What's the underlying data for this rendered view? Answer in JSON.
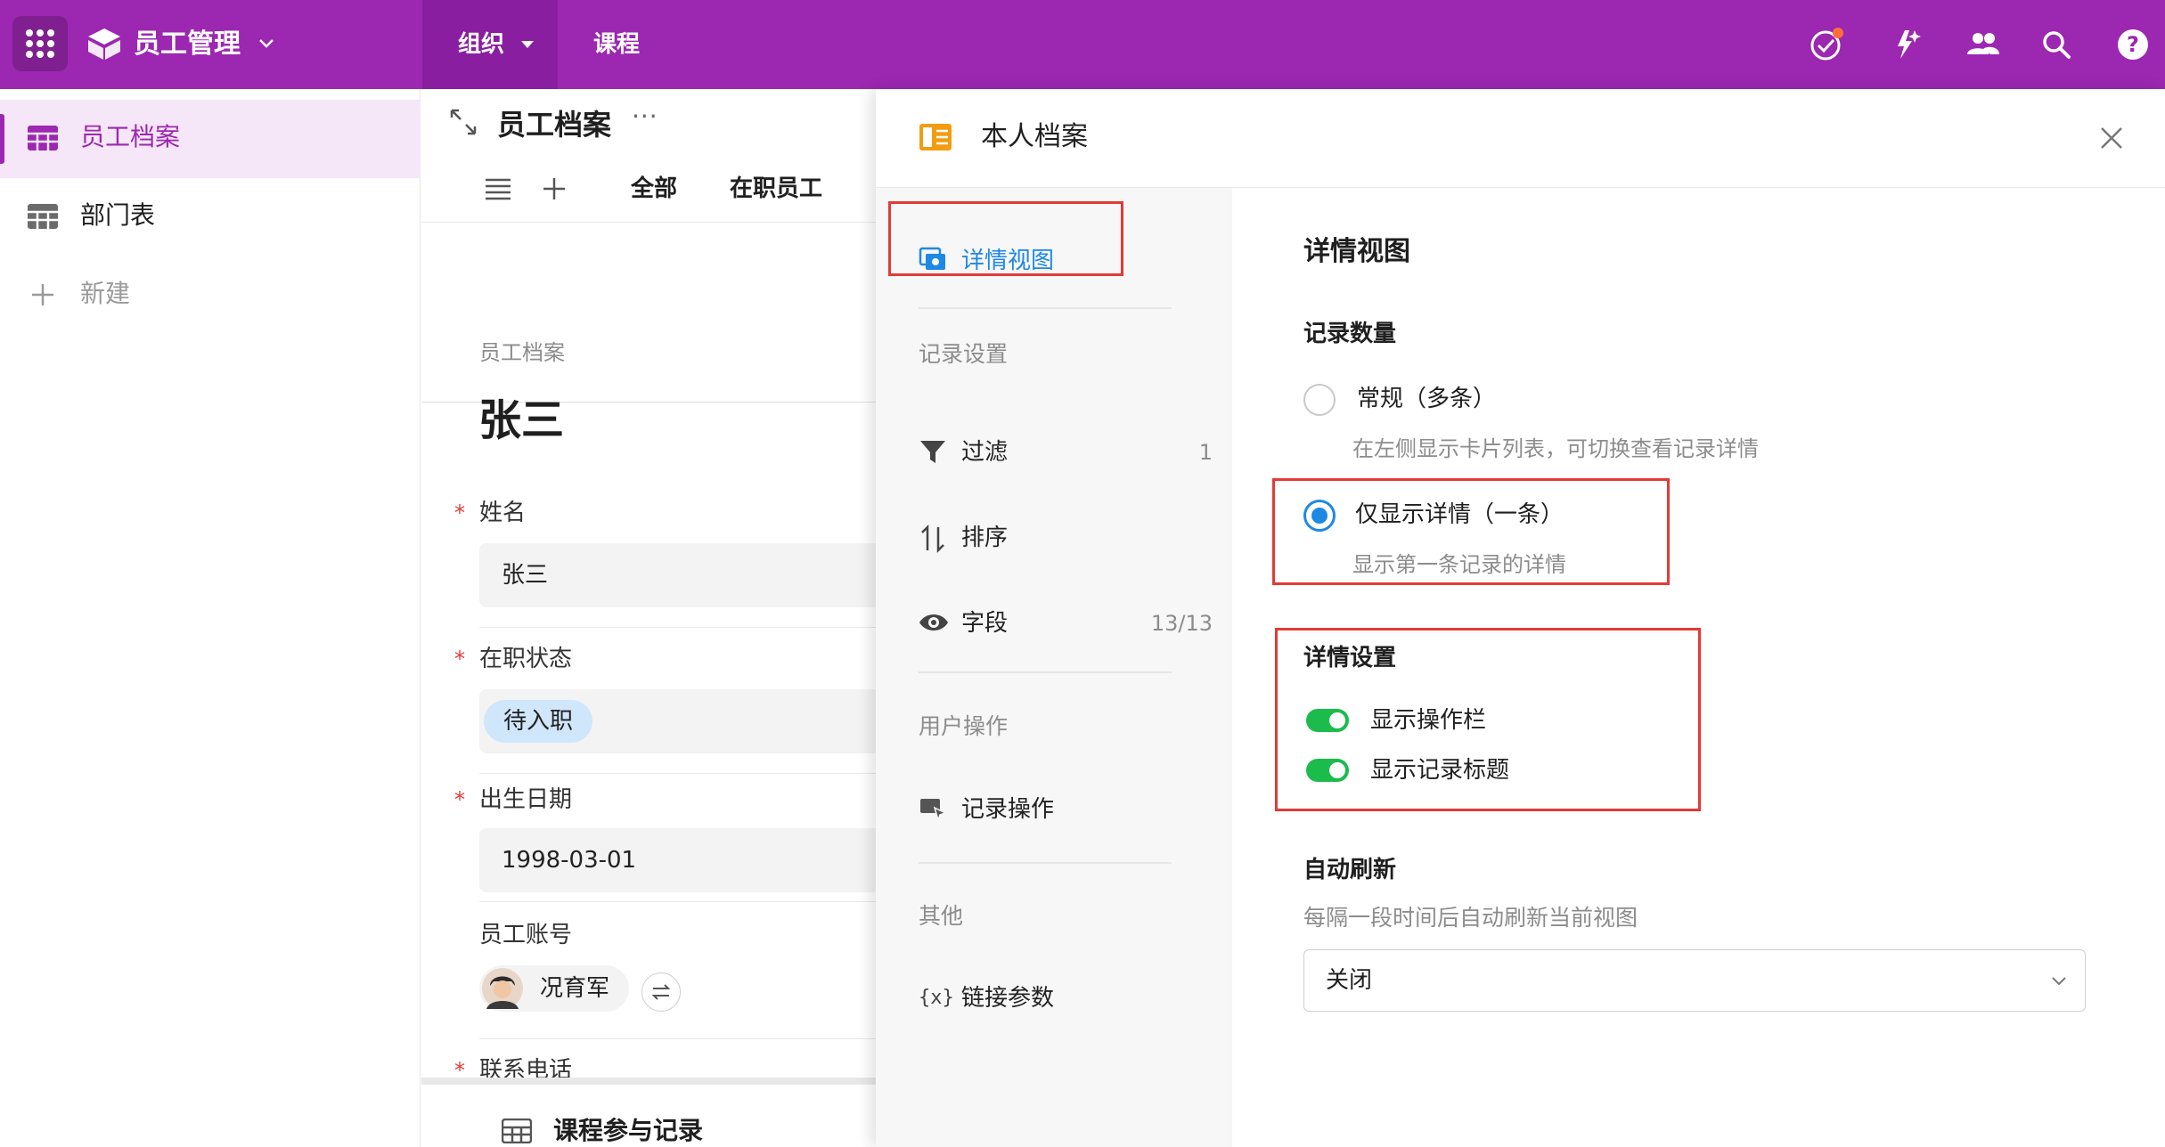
{
  "topbar": {
    "app_title": "员工管理",
    "nav_tabs": [
      {
        "label": "组织",
        "active": true
      },
      {
        "label": "课程",
        "active": false
      }
    ],
    "accent_color": "#9c27b0",
    "icons": [
      "apps-grid-icon",
      "cube-logo-icon",
      "task-check-icon",
      "ai-sparkle-icon",
      "people-icon",
      "search-icon",
      "help-icon"
    ]
  },
  "sidebar": {
    "items": [
      {
        "label": "员工档案",
        "active": true,
        "icon": "table-icon"
      },
      {
        "label": "部门表",
        "active": false,
        "icon": "table-icon"
      },
      {
        "label": "新建",
        "active": false,
        "icon": "plus-icon"
      }
    ]
  },
  "record": {
    "header_title": "员工档案",
    "toolbar_tabs": [
      "全部",
      "在职员工"
    ],
    "breadcrumb": "员工档案",
    "title": "张三",
    "fields": {
      "name_label": "姓名",
      "name_value": "张三",
      "status_label": "在职状态",
      "status_value": "待入职",
      "birth_label": "出生日期",
      "birth_value": "1998-03-01",
      "account_label": "员工账号",
      "account_value": "况育军",
      "phone_label": "联系电话"
    },
    "sub_table": "课程参与记录"
  },
  "drawer": {
    "title": "本人档案",
    "nav": {
      "detail_view": "详情视图",
      "record_settings_group": "记录设置",
      "filter": {
        "label": "过滤",
        "count": "1"
      },
      "sort": {
        "label": "排序"
      },
      "fields": {
        "label": "字段",
        "count": "13/13"
      },
      "user_actions_group": "用户操作",
      "record_actions": "记录操作",
      "other_group": "其他",
      "link_params": "链接参数"
    },
    "content": {
      "heading": "详情视图",
      "record_count_label": "记录数量",
      "option_normal": "常规（多条）",
      "option_normal_desc": "在左侧显示卡片列表，可切换查看记录详情",
      "option_single": "仅显示详情（一条）",
      "option_single_desc": "显示第一条记录的详情",
      "selected_option": "仅显示详情（一条）",
      "detail_settings_label": "详情设置",
      "toggle_action_bar": {
        "label": "显示操作栏",
        "on": true
      },
      "toggle_record_title": {
        "label": "显示记录标题",
        "on": true
      },
      "auto_refresh_label": "自动刷新",
      "auto_refresh_desc": "每隔一段时间后自动刷新当前视图",
      "auto_refresh_value": "关闭"
    }
  }
}
